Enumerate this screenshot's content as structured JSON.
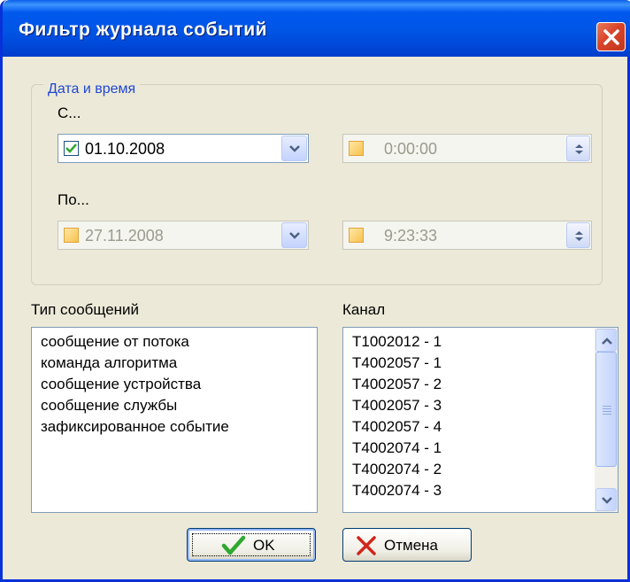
{
  "window": {
    "title": "Фильтр журнала событий"
  },
  "date_group": {
    "legend": "Дата и время",
    "from_label": "С...",
    "to_label": "По...",
    "from_date": {
      "value": "01.10.2008",
      "checked": true
    },
    "from_time": {
      "value": "0:00:00",
      "checked": false
    },
    "to_date": {
      "value": "27.11.2008",
      "checked": false
    },
    "to_time": {
      "value": "9:23:33",
      "checked": false
    }
  },
  "message_types": {
    "label": "Тип сообщений",
    "items": [
      "сообщение от потока",
      "команда алгоритма",
      "сообщение устройства",
      "сообщение службы",
      "зафиксированное событие"
    ]
  },
  "channels": {
    "label": "Канал",
    "items": [
      "T1002012 - 1",
      "T4002057 - 1",
      "T4002057 - 2",
      "T4002057 - 3",
      "T4002057 - 4",
      "T4002074 - 1",
      "T4002074 - 2",
      "T4002074 - 3"
    ]
  },
  "buttons": {
    "ok": "OK",
    "cancel": "Отмена"
  },
  "icons": {
    "close": "close-icon",
    "checkmark": "check-icon",
    "dropdown": "chevron-down-icon",
    "spinner": "spin-updown-icon",
    "cancel": "red-x-icon"
  },
  "colors": {
    "titlebar": "#0055E5",
    "dialog_bg": "#ECE9D8",
    "legend_text": "#1F47D2",
    "checkmark": "#2FA82F",
    "cancel_x": "#D0261B"
  }
}
